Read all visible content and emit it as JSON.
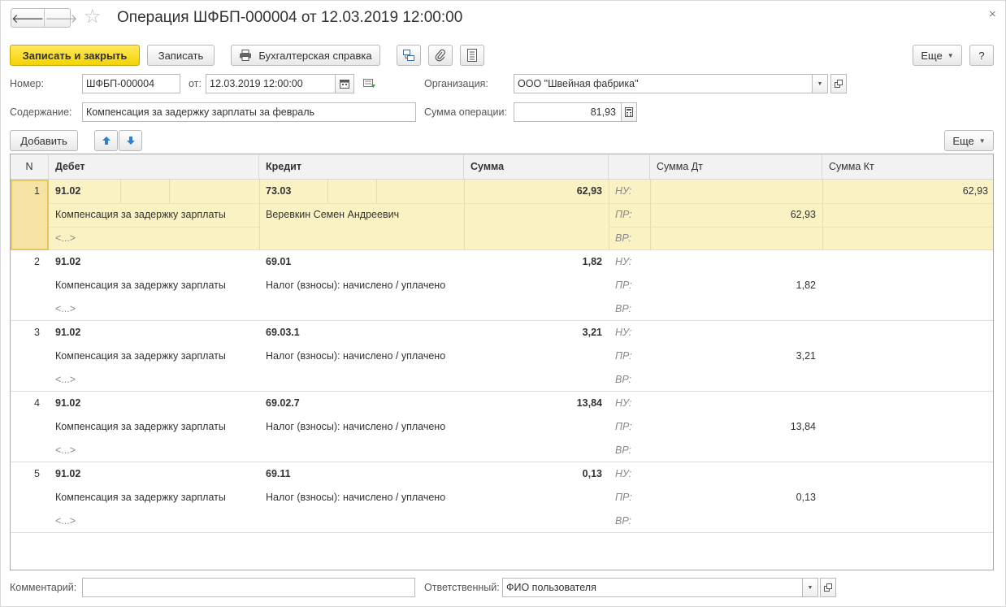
{
  "window": {
    "title": "Операция ШФБП-000004 от 12.03.2019 12:00:00",
    "back_glyph": "🡐",
    "forward_glyph": "🡒",
    "star_glyph": "☆",
    "close_glyph": "×"
  },
  "toolbar": {
    "save_close_label": "Записать и закрыть",
    "save_label": "Записать",
    "print_label": "Бухгалтерская справка",
    "more_label": "Еще",
    "help_label": "?"
  },
  "form": {
    "number_label": "Номер:",
    "number_value": "ШФБП-000004",
    "date_label": "от:",
    "date_value": "12.03.2019 12:00:00",
    "org_label": "Организация:",
    "org_value": "ООО \"Швейная фабрика\"",
    "content_label": "Содержание:",
    "content_value": "Компенсация за задержку зарплаты за февраль",
    "sum_label": "Сумма операции:",
    "sum_value": "81,93"
  },
  "table_toolbar": {
    "add_label": "Добавить",
    "more_label": "Еще"
  },
  "table": {
    "columns": {
      "n": "N",
      "debit": "Дебет",
      "credit": "Кредит",
      "sum": "Сумма",
      "sum_dt": "Сумма Дт",
      "sum_kt": "Сумма Кт"
    },
    "rows": [
      {
        "n": "1",
        "debit": "91.02",
        "credit": "73.03",
        "sum": "62,93",
        "debit_sub": "Компенсация за задержку зарплаты",
        "credit_sub": "Веревкин Семен Андреевич",
        "debit_sub2": "<...>",
        "nu": "НУ:",
        "pr": "ПР:",
        "vr": "ВР:",
        "dt_pr": "62,93",
        "kt_nu": "62,93"
      },
      {
        "n": "2",
        "debit": "91.02",
        "credit": "69.01",
        "sum": "1,82",
        "debit_sub": "Компенсация за задержку зарплаты",
        "credit_sub": "Налог (взносы): начислено / уплачено",
        "debit_sub2": "<...>",
        "nu": "НУ:",
        "pr": "ПР:",
        "vr": "ВР:",
        "dt_pr": "1,82",
        "kt_nu": ""
      },
      {
        "n": "3",
        "debit": "91.02",
        "credit": "69.03.1",
        "sum": "3,21",
        "debit_sub": "Компенсация за задержку зарплаты",
        "credit_sub": "Налог (взносы): начислено / уплачено",
        "debit_sub2": "<...>",
        "nu": "НУ:",
        "pr": "ПР:",
        "vr": "ВР:",
        "dt_pr": "3,21",
        "kt_nu": ""
      },
      {
        "n": "4",
        "debit": "91.02",
        "credit": "69.02.7",
        "sum": "13,84",
        "debit_sub": "Компенсация за задержку зарплаты",
        "credit_sub": "Налог (взносы): начислено / уплачено",
        "debit_sub2": "<...>",
        "nu": "НУ:",
        "pr": "ПР:",
        "vr": "ВР:",
        "dt_pr": "13,84",
        "kt_nu": ""
      },
      {
        "n": "5",
        "debit": "91.02",
        "credit": "69.11",
        "sum": "0,13",
        "debit_sub": "Компенсация за задержку зарплаты",
        "credit_sub": "Налог (взносы): начислено / уплачено",
        "debit_sub2": "<...>",
        "nu": "НУ:",
        "pr": "ПР:",
        "vr": "ВР:",
        "dt_pr": "0,13",
        "kt_nu": ""
      }
    ]
  },
  "footer": {
    "comment_label": "Комментарий:",
    "comment_value": "",
    "responsible_label": "Ответственный:",
    "responsible_value": "ФИО пользователя"
  },
  "colors": {
    "primary_button": "#f5d300",
    "selected_row": "#fbf2c4"
  }
}
